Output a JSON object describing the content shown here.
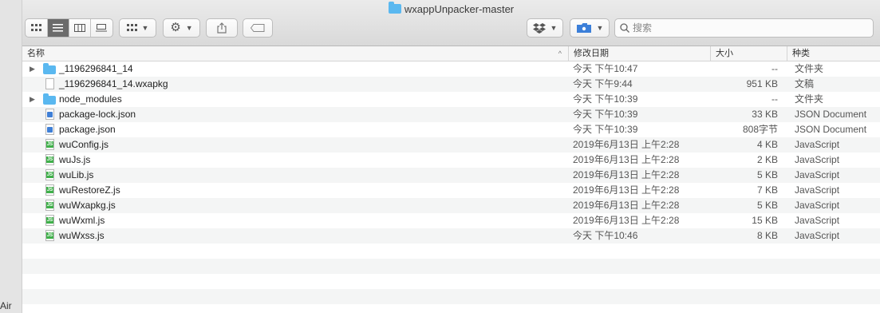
{
  "window": {
    "title": "wxappUnpacker-master"
  },
  "left_strip": {
    "fragment": "Air"
  },
  "toolbar": {
    "view_icons": [
      "grid-view-icon",
      "list-view-icon",
      "column-view-icon",
      "gallery-view-icon"
    ],
    "active_view": "list-view",
    "search": {
      "placeholder": "搜索"
    }
  },
  "columns": {
    "name": "名称",
    "date": "修改日期",
    "size": "大小",
    "kind": "种类"
  },
  "files": [
    {
      "name": "_1196296841_14",
      "date": "今天 下午10:47",
      "size": "--",
      "kind": "文件夹",
      "icon": "folder-icon",
      "expandable": true
    },
    {
      "name": "_1196296841_14.wxapkg",
      "date": "今天 下午9:44",
      "size": "951 KB",
      "kind": "文稿",
      "icon": "document-icon",
      "expandable": false
    },
    {
      "name": "node_modules",
      "date": "今天 下午10:39",
      "size": "--",
      "kind": "文件夹",
      "icon": "folder-icon",
      "expandable": true
    },
    {
      "name": "package-lock.json",
      "date": "今天 下午10:39",
      "size": "33 KB",
      "kind": "JSON Document",
      "icon": "json-file-icon",
      "expandable": false
    },
    {
      "name": "package.json",
      "date": "今天 下午10:39",
      "size": "808字节",
      "kind": "JSON Document",
      "icon": "json-file-icon",
      "expandable": false
    },
    {
      "name": "wuConfig.js",
      "date": "2019年6月13日 上午2:28",
      "size": "4 KB",
      "kind": "JavaScript",
      "icon": "js-file-icon",
      "expandable": false
    },
    {
      "name": "wuJs.js",
      "date": "2019年6月13日 上午2:28",
      "size": "2 KB",
      "kind": "JavaScript",
      "icon": "js-file-icon",
      "expandable": false
    },
    {
      "name": "wuLib.js",
      "date": "2019年6月13日 上午2:28",
      "size": "5 KB",
      "kind": "JavaScript",
      "icon": "js-file-icon",
      "expandable": false
    },
    {
      "name": "wuRestoreZ.js",
      "date": "2019年6月13日 上午2:28",
      "size": "7 KB",
      "kind": "JavaScript",
      "icon": "js-file-icon",
      "expandable": false
    },
    {
      "name": "wuWxapkg.js",
      "date": "2019年6月13日 上午2:28",
      "size": "5 KB",
      "kind": "JavaScript",
      "icon": "js-file-icon",
      "expandable": false
    },
    {
      "name": "wuWxml.js",
      "date": "2019年6月13日 上午2:28",
      "size": "15 KB",
      "kind": "JavaScript",
      "icon": "js-file-icon",
      "expandable": false
    },
    {
      "name": "wuWxss.js",
      "date": "今天 下午10:46",
      "size": "8 KB",
      "kind": "JavaScript",
      "icon": "js-file-icon",
      "expandable": false
    }
  ]
}
